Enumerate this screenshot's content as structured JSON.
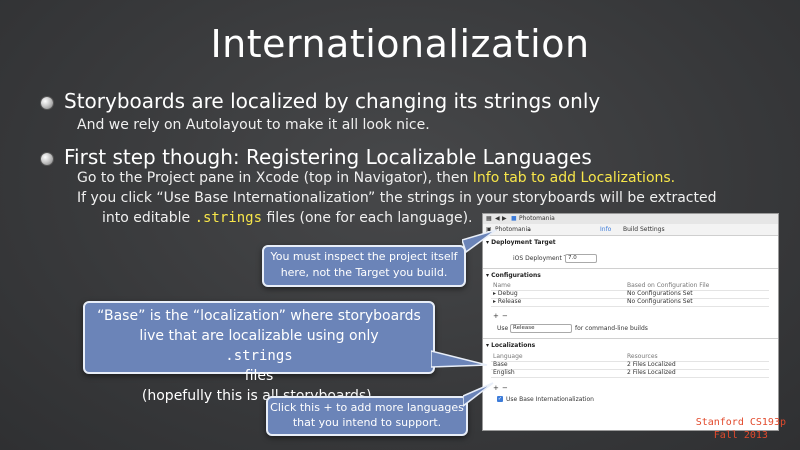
{
  "title": "Internationalization",
  "bullets": [
    {
      "heading": "Storyboards are localized by changing its strings only",
      "sub": [
        "And we rely on Autolayout to make it all look nice."
      ]
    },
    {
      "heading": "First step though: Registering Localizable Languages",
      "sub_line1_a": "Go to the Project pane in Xcode (top in Navigator), then ",
      "sub_line1_b": "Info tab to add Localizations.",
      "sub_line2": "If you click “Use Base Internationalization” the strings in your storyboards will be extracted",
      "sub_line3_a": "into editable ",
      "sub_line3_code": ".strings",
      "sub_line3_b": " files (one for each language)."
    }
  ],
  "xcode": {
    "project_name": "Photomania",
    "target_popup": "Photomania",
    "tabs": {
      "info": "Info",
      "build_settings": "Build Settings"
    },
    "deployment": {
      "section": "Deployment Target",
      "label": "iOS Deployment Target",
      "value": "7.0"
    },
    "configurations": {
      "section": "Configurations",
      "headers": [
        "Name",
        "Based on Configuration File"
      ],
      "rows": [
        [
          "Debug",
          "No Configurations Set"
        ],
        [
          "Release",
          "No Configurations Set"
        ]
      ],
      "use_label": "Use",
      "use_value": "Release",
      "use_suffix": "for command-line builds"
    },
    "localizations": {
      "section": "Localizations",
      "headers": [
        "Language",
        "Resources"
      ],
      "rows": [
        [
          "Base",
          "2 Files Localized"
        ],
        [
          "English",
          "2 Files Localized"
        ]
      ],
      "checkbox_label": "Use Base Internationalization"
    },
    "plus": "+",
    "minus": "−"
  },
  "callouts": {
    "project": [
      "You must inspect the project itself",
      "here, not the Target you build."
    ],
    "base_line1": "“Base” is the “localization” where storyboards",
    "base_line2_a": "live that are localizable using only ",
    "base_line2_code": ".strings",
    "base_line2_b": " files",
    "base_line3": "(hopefully this is all storyboards).",
    "plus": [
      "Click this + to add more languages",
      "that you intend to support."
    ]
  },
  "footer": [
    "Stanford CS193p",
    "Fall 2013"
  ],
  "colors": {
    "background": "#3b3c3e",
    "highlight_yellow": "#f7e64a",
    "callout_blue": "#6b84b8",
    "stanford_red": "#e24a2c"
  }
}
